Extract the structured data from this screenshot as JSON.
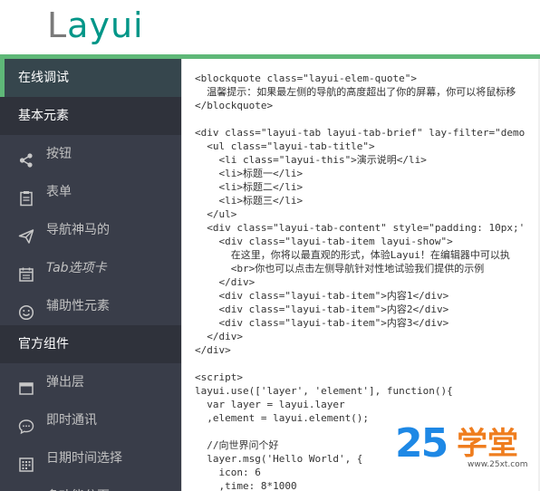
{
  "header": {
    "logo_part1": "L",
    "logo_part2": "ayui"
  },
  "sidebar": {
    "items": [
      {
        "label": "在线调试",
        "kind": "active"
      },
      {
        "label": "基本元素",
        "kind": "section"
      },
      {
        "label": "按钮",
        "icon": "share-icon"
      },
      {
        "label": "表单",
        "icon": "clipboard-icon"
      },
      {
        "label": "导航神马的",
        "icon": "paper-plane-icon"
      },
      {
        "label": "Tab选项卡",
        "icon": "calendar-icon"
      },
      {
        "label": "辅助性元素",
        "icon": "smile-icon"
      },
      {
        "label": "官方组件",
        "kind": "section"
      },
      {
        "label": "弹出层",
        "icon": "window-icon"
      },
      {
        "label": "即时通讯",
        "icon": "chat-icon"
      },
      {
        "label": "日期时间选择",
        "icon": "grid-calendar-icon"
      },
      {
        "label": "多功能分页",
        "icon": "pagination-icon"
      }
    ]
  },
  "code": {
    "lines": [
      "<blockquote class=\"layui-elem-quote\">",
      "  温馨提示：如果最左侧的导航的高度超出了你的屏幕，你可以将鼠标移",
      "</blockquote>",
      "",
      "<div class=\"layui-tab layui-tab-brief\" lay-filter=\"demo",
      "  <ul class=\"layui-tab-title\">",
      "    <li class=\"layui-this\">演示说明</li>",
      "    <li>标题一</li>",
      "    <li>标题二</li>",
      "    <li>标题三</li>",
      "  </ul>",
      "  <div class=\"layui-tab-content\" style=\"padding: 10px;'",
      "    <div class=\"layui-tab-item layui-show\">",
      "      在这里，你将以最直观的形式，体验Layui！在编辑器中可以执",
      "      <br>你也可以点击左侧导航针对性地试验我们提供的示例",
      "    </div>",
      "    <div class=\"layui-tab-item\">内容1</div>",
      "    <div class=\"layui-tab-item\">内容2</div>",
      "    <div class=\"layui-tab-item\">内容3</div>",
      "  </div>",
      "</div>",
      "",
      "<script>",
      "layui.use(['layer', 'element'], function(){",
      "  var layer = layui.layer",
      "  ,element = layui.element();",
      "",
      "  //向世界问个好",
      "  layer.msg('Hello World', {",
      "    icon: 6",
      "    ,time: 8*1000"
    ]
  },
  "watermark": {
    "number": "25",
    "text": "学堂",
    "url": "www.25xt.com"
  }
}
